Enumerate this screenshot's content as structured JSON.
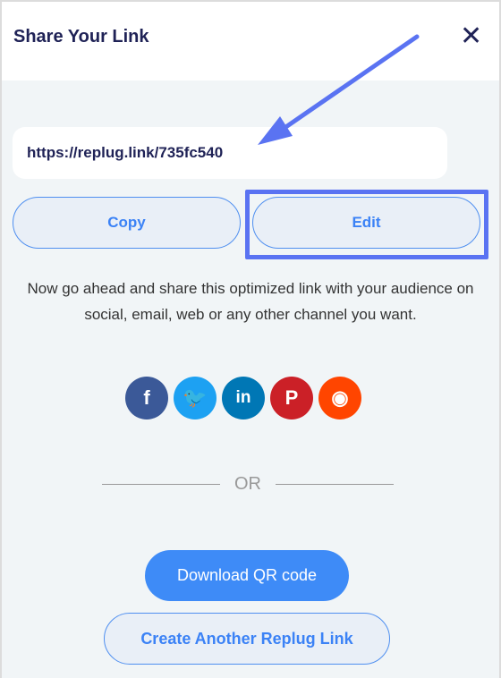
{
  "header": {
    "title": "Share Your Link",
    "close_icon": "close-icon"
  },
  "link": {
    "value": "https://replug.link/735fc540"
  },
  "buttons": {
    "copy": "Copy",
    "edit": "Edit",
    "download_qr": "Download QR code",
    "create_another": "Create Another Replug Link"
  },
  "description": "Now go ahead and share this optimized link with your audience on social, email, web or any other channel you want.",
  "social": [
    {
      "name": "facebook",
      "color": "#3b5998",
      "glyph": "f"
    },
    {
      "name": "twitter",
      "color": "#1da1f2",
      "glyph": "🐦"
    },
    {
      "name": "linkedin",
      "color": "#0077b5",
      "glyph": "in"
    },
    {
      "name": "pinterest",
      "color": "#cb2027",
      "glyph": "P"
    },
    {
      "name": "reddit",
      "color": "#ff4500",
      "glyph": "◉"
    }
  ],
  "divider": "OR",
  "colors": {
    "accent": "#3e8bf7",
    "annotation": "#5a73f2",
    "title": "#1f2256"
  }
}
